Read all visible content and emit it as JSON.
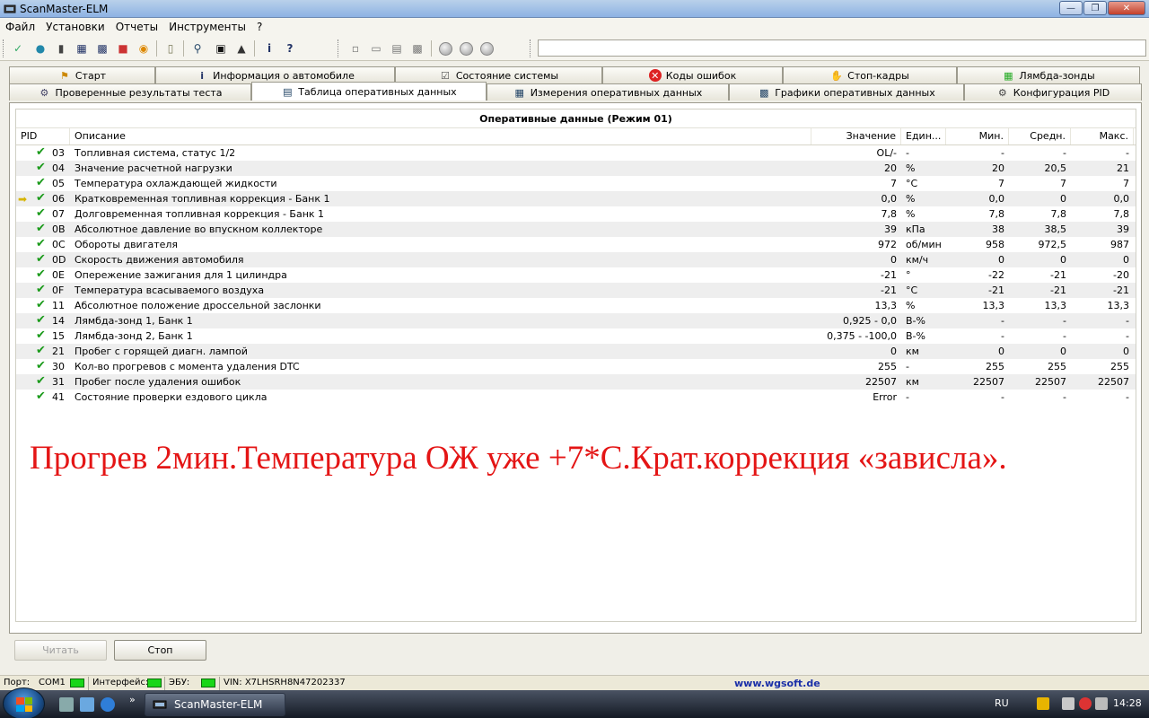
{
  "window": {
    "title": "ScanMaster-ELM"
  },
  "menu": [
    "Файл",
    "Установки",
    "Отчеты",
    "Инструменты",
    "?"
  ],
  "toolbar": {
    "icons": [
      "wizard-icon",
      "globe-icon",
      "device-icon",
      "grid-icon",
      "chart-icon",
      "pid-icon",
      "traffic-icon",
      "clipboard-icon",
      "search-icon",
      "terminal-icon",
      "dtc-icon",
      "info-icon",
      "help-icon",
      "new-icon",
      "open-icon",
      "save-icon",
      "print-icon",
      "play-icon",
      "pause-icon",
      "stop-icon"
    ],
    "progress": 0.0
  },
  "tabs_row1": [
    {
      "label": "Старт",
      "icon": "start-icon"
    },
    {
      "label": "Информация о автомобиле",
      "icon": "info-icon"
    },
    {
      "label": "Состояние системы",
      "icon": "status-icon"
    },
    {
      "label": "Коды ошибок",
      "icon": "error-icon"
    },
    {
      "label": "Стоп-кадры",
      "icon": "freeze-icon"
    },
    {
      "label": "Лямбда-зонды",
      "icon": "lambda-icon"
    }
  ],
  "tabs_row2": [
    {
      "label": "Проверенные результаты теста",
      "icon": "gear-icon"
    },
    {
      "label": "Таблица оперативных данных",
      "icon": "table-icon",
      "active": true
    },
    {
      "label": "Измерения оперативных данных",
      "icon": "grid-icon"
    },
    {
      "label": "Графики оперативных данных",
      "icon": "chart-icon"
    },
    {
      "label": "Конфигурация PID",
      "icon": "config-icon"
    }
  ],
  "grid": {
    "title": "Оперативные данные (Режим 01)",
    "columns": {
      "pid": "PID",
      "desc": "Описание",
      "value": "Значение",
      "unit": "Един...",
      "min": "Мин.",
      "avg": "Средн.",
      "max": "Макс."
    },
    "rows": [
      {
        "pid": "03",
        "desc": "Топливная система, статус 1/2",
        "value": "OL/-",
        "unit": "-",
        "min": "-",
        "avg": "-",
        "max": "-"
      },
      {
        "pid": "04",
        "desc": "Значение расчетной нагрузки",
        "value": "20",
        "unit": "%",
        "min": "20",
        "avg": "20,5",
        "max": "21"
      },
      {
        "pid": "05",
        "desc": "Температура охлаждающей жидкости",
        "value": "7",
        "unit": "°C",
        "min": "7",
        "avg": "7",
        "max": "7"
      },
      {
        "pid": "06",
        "desc": "Кратковременная топливная коррекция - Банк 1",
        "value": "0,0",
        "unit": "%",
        "min": "0,0",
        "avg": "0",
        "max": "0,0",
        "selected": true
      },
      {
        "pid": "07",
        "desc": "Долговременная топливная коррекция - Банк 1",
        "value": "7,8",
        "unit": "%",
        "min": "7,8",
        "avg": "7,8",
        "max": "7,8"
      },
      {
        "pid": "0B",
        "desc": "Абсолютное давление во впускном коллекторе",
        "value": "39",
        "unit": "кПа",
        "min": "38",
        "avg": "38,5",
        "max": "39"
      },
      {
        "pid": "0C",
        "desc": "Обороты двигателя",
        "value": "972",
        "unit": "об/мин",
        "min": "958",
        "avg": "972,5",
        "max": "987"
      },
      {
        "pid": "0D",
        "desc": "Скорость движения автомобиля",
        "value": "0",
        "unit": "км/ч",
        "min": "0",
        "avg": "0",
        "max": "0"
      },
      {
        "pid": "0E",
        "desc": "Опережение зажигания для 1 цилиндра",
        "value": "-21",
        "unit": "°",
        "min": "-22",
        "avg": "-21",
        "max": "-20"
      },
      {
        "pid": "0F",
        "desc": "Температура  всасываемого воздуха",
        "value": "-21",
        "unit": "°C",
        "min": "-21",
        "avg": "-21",
        "max": "-21"
      },
      {
        "pid": "11",
        "desc": "Абсолютное положение дроссельной заслонки",
        "value": "13,3",
        "unit": "%",
        "min": "13,3",
        "avg": "13,3",
        "max": "13,3"
      },
      {
        "pid": "14",
        "desc": "Лямбда-зонд 1, Банк 1",
        "value": "0,925 - 0,0",
        "unit": "В-%",
        "min": "-",
        "avg": "-",
        "max": "-"
      },
      {
        "pid": "15",
        "desc": "Лямбда-зонд 2, Банк 1",
        "value": "0,375 - -100,0",
        "unit": "В-%",
        "min": "-",
        "avg": "-",
        "max": "-"
      },
      {
        "pid": "21",
        "desc": "Пробег с горящей диагн. лампой",
        "value": "0",
        "unit": "км",
        "min": "0",
        "avg": "0",
        "max": "0"
      },
      {
        "pid": "30",
        "desc": "Кол-во прогревов с момента удаления DTC",
        "value": "255",
        "unit": "-",
        "min": "255",
        "avg": "255",
        "max": "255"
      },
      {
        "pid": "31",
        "desc": "Пробег после удаления ошибок",
        "value": "22507",
        "unit": "км",
        "min": "22507",
        "avg": "22507",
        "max": "22507"
      },
      {
        "pid": "41",
        "desc": "Состояние проверки ездового цикла",
        "value": "Error",
        "unit": "-",
        "min": "-",
        "avg": "-",
        "max": "-"
      }
    ]
  },
  "overlay_text": "Прогрев 2мин.Температура ОЖ уже +7*С.Крат.коррекция «зависла».",
  "buttons": {
    "read": "Читать",
    "stop": "Стоп"
  },
  "statusbar": {
    "port_label": "Порт:",
    "port_value": "COM1",
    "interface_label": "Интерфейс:",
    "ecu_label": "ЭБУ:",
    "vin": "VIN: X7LHSRH8N47202337",
    "link": "www.wgsoft.de"
  },
  "taskbar": {
    "window_button": "ScanMaster-ELM",
    "lang": "RU",
    "clock": "14:28"
  },
  "colors": {
    "accent": "#1a9a1a",
    "overlay": "#e41515",
    "link": "#1a2fa8"
  }
}
